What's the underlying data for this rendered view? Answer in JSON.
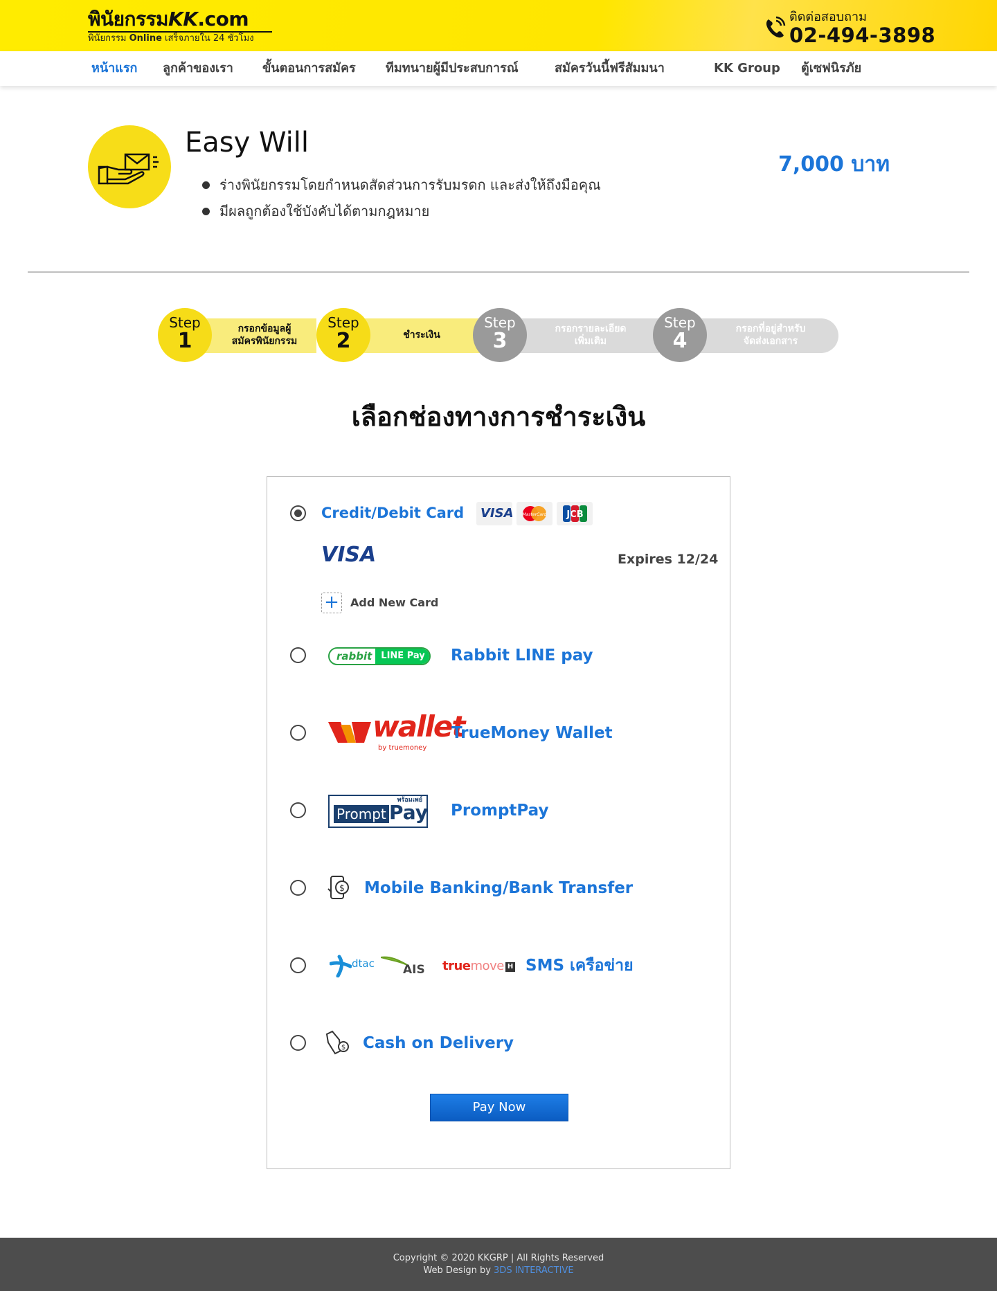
{
  "header": {
    "logo_main": "พินัยกรรม",
    "logo_kk": "KK",
    "logo_com": ".com",
    "logo_sub_a": "พินัยกรรม ",
    "logo_sub_b": "Online",
    "logo_sub_c": " เสร็จภายใน 24 ชั่วโมง",
    "contact_label": "ติดต่อสอบถาม",
    "contact_number": "02-494-3898",
    "colors": {
      "bar": "#ffe600"
    }
  },
  "nav": {
    "items": [
      {
        "label": "หน้าแรก",
        "active": true
      },
      {
        "label": "ลูกค้าของเรา"
      },
      {
        "label": "ขั้นตอนการสมัคร"
      },
      {
        "label": "ทีมทนายผู้มีประสบการณ์"
      },
      {
        "label": "สมัครวันนี้ฟรีสัมมนา"
      },
      {
        "label": "KK Group"
      },
      {
        "label": "ตู้เซฟนิรภัย"
      }
    ],
    "active_color": "#1c75d8"
  },
  "product": {
    "icon": "hand-envelope-icon",
    "title": "Easy Will",
    "bullets": [
      "ร่างพินัยกรรมโดยกำหนดสัดส่วนการรับมรดก และส่งให้ถึงมือคุณ",
      "มีผลถูกต้องใช้บังคับได้ตามกฎหมาย"
    ],
    "price": "7,000 บาท"
  },
  "steps": [
    {
      "word": "Step",
      "num": "1",
      "label_1": "กรอกข้อมูลผู้",
      "label_2": "สมัครพินัยกรรม",
      "status": "done"
    },
    {
      "word": "Step",
      "num": "2",
      "label_1": "ชำระเงิน",
      "label_2": "",
      "status": "done"
    },
    {
      "word": "Step",
      "num": "3",
      "label_1": "กรอกรายละเอียด",
      "label_2": "เพิ่มเติม",
      "status": "todo"
    },
    {
      "word": "Step",
      "num": "4",
      "label_1": "กรอกที่อยู่สำหรับ",
      "label_2": "จัดส่งเอกสาร",
      "status": "todo"
    }
  ],
  "payment": {
    "title": "เลือกช่องทางการชำระเงิน",
    "card": {
      "label": "Credit/Debit Card",
      "selected": true,
      "brands": [
        "VISA",
        "MasterCard",
        "JCB"
      ],
      "saved_brand": "VISA",
      "expires": "Expires 12/24",
      "add_new": "Add New Card"
    },
    "rabbit": {
      "label": "Rabbit LINE pay",
      "logo_a": "rabbit",
      "logo_b": "LINE Pay"
    },
    "truemoney": {
      "label": "TrueMoney Wallet",
      "logo_text": "wallet",
      "logo_sub": "by truemoney"
    },
    "promptpay": {
      "label": "PromptPay",
      "logo_small": "พร้อมเพย์",
      "logo_a": "Prompt",
      "logo_b": "Pay"
    },
    "banking": {
      "label": "Mobile Banking/Bank Transfer"
    },
    "sms": {
      "label": "SMS เครือข่าย",
      "dtac": "dtac",
      "ais": "AIS",
      "true_a": "true",
      "true_b": "move",
      "true_c": "H"
    },
    "cod": {
      "label": "Cash on Delivery"
    },
    "pay_now": "Pay Now",
    "label_color": "#1c75d8"
  },
  "footer": {
    "copyright": "Copyright © 2020 KKGRP | All Rights Reserved",
    "design_prefix": "Web Design by ",
    "design_link": "3DS INTERACTIVE"
  }
}
